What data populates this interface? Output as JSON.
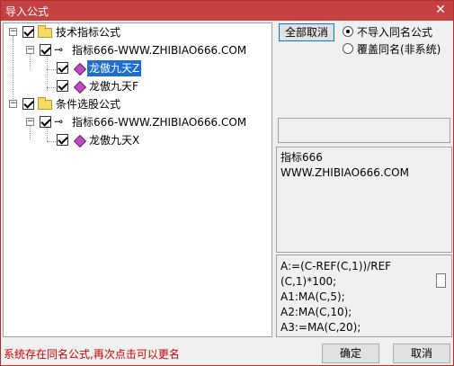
{
  "window": {
    "title": "导入公式",
    "close_glyph": "✕"
  },
  "tree": {
    "group1": {
      "label": "技术指标公式",
      "child": {
        "label": "指标666-WWW.ZHIBIAO666.COM",
        "items": [
          "龙傲九天Z",
          "龙傲九天F"
        ]
      }
    },
    "group2": {
      "label": "条件选股公式",
      "child": {
        "label": "指标666-WWW.ZHIBIAO666.COM",
        "items": [
          "龙傲九天X"
        ]
      }
    }
  },
  "controls": {
    "deselect_all": "全部取消",
    "radio_no_import": "不导入同名公式",
    "radio_overwrite": "覆盖同名(非系统)"
  },
  "info": {
    "line1": "指标666",
    "line2": "WWW.ZHIBIAO666.COM"
  },
  "code_lines": [
    "A:=(C-REF(C,1))/REF",
    "(C,1)*100;",
    "A1:MA(C,5);",
    "A2:MA(C,10);",
    "A3:=MA(C,20);"
  ],
  "status": "系统存在同名公式,再次点击可以更名",
  "buttons": {
    "ok": "确定",
    "cancel": "取消"
  }
}
